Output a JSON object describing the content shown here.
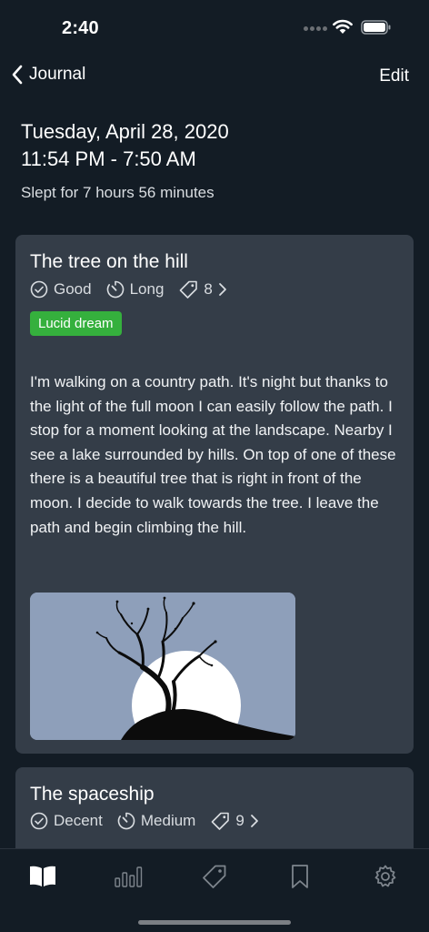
{
  "status_bar": {
    "time": "2:40"
  },
  "nav": {
    "back_label": "Journal",
    "edit_label": "Edit"
  },
  "header": {
    "date": "Tuesday, April 28, 2020",
    "time_range": "11:54 PM - 7:50 AM",
    "slept": "Slept for 7 hours 56 minutes"
  },
  "entries": [
    {
      "title": "The tree on the hill",
      "quality": "Good",
      "length": "Long",
      "tag_count": "8",
      "tag": "Lucid dream",
      "text": "I'm walking on a country path. It's night but thanks to the light of the full moon I can easily follow the path. I stop for a moment looking at the landscape. Nearby I see a lake surrounded by hills. On top of one of these there is a beautiful tree that is right in front of the moon. I decide to walk towards the tree. I leave the path and begin climbing the hill."
    },
    {
      "title": "The spaceship",
      "quality": "Decent",
      "length": "Medium",
      "tag_count": "9"
    }
  ],
  "tabs": [
    {
      "icon": "book-icon",
      "active": true
    },
    {
      "icon": "bar-chart-icon",
      "active": false
    },
    {
      "icon": "tag-icon",
      "active": false
    },
    {
      "icon": "bookmark-icon",
      "active": false
    },
    {
      "icon": "gear-icon",
      "active": false
    }
  ],
  "colors": {
    "background": "#131c25",
    "card": "#343d48",
    "lucid_tag": "#35b03d",
    "image_sky": "#8e9fba"
  }
}
